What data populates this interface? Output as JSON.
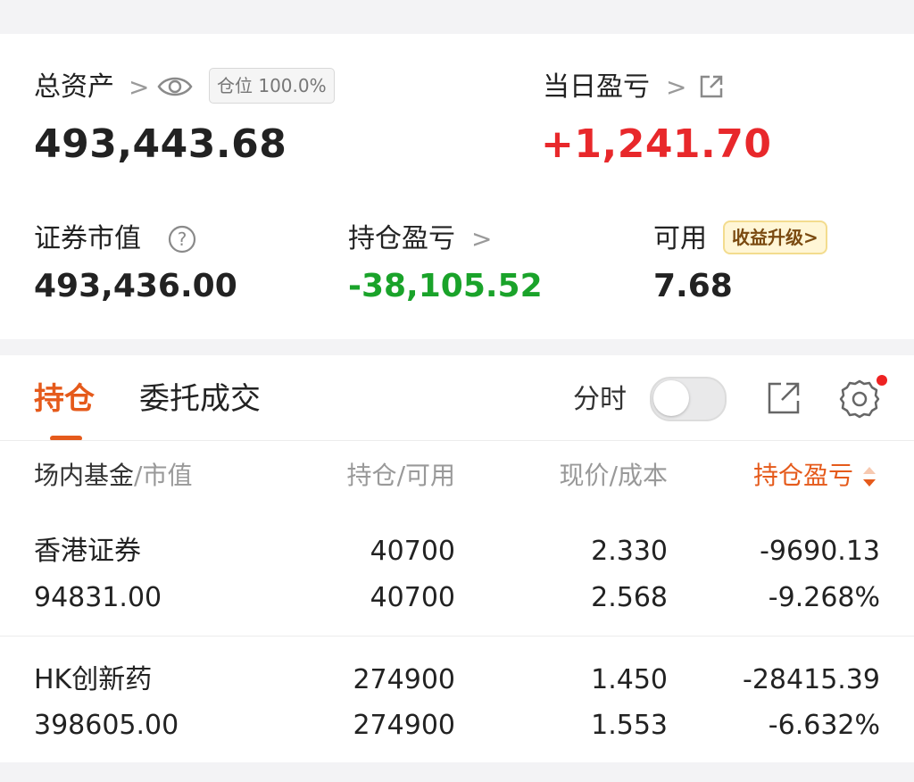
{
  "summary": {
    "total_assets_label": "总资产",
    "position_badge": "仓位 100.0%",
    "total_assets_value": "493,443.68",
    "daily_pnl_label": "当日盈亏",
    "daily_pnl_value": "+1,241.70",
    "securities_value_label": "证券市值",
    "securities_value": "493,436.00",
    "holding_pnl_label": "持仓盈亏",
    "holding_pnl_value": "-38,105.52",
    "available_label": "可用",
    "available_value": "7.68",
    "upgrade_badge": "收益升级>"
  },
  "tabs": {
    "positions": "持仓",
    "orders": "委托成交",
    "timeshare_label": "分时"
  },
  "table": {
    "col1_main": "场内基金",
    "col1_sub": "/市值",
    "col2_main": "持仓",
    "col2_sub": "/可用",
    "col3_main": "现价",
    "col3_sub": "/成本",
    "col4": "持仓盈亏",
    "rows": [
      {
        "name": "香港证券",
        "market_value": "94831.00",
        "holding": "40700",
        "available": "40700",
        "price": "2.330",
        "cost": "2.568",
        "pnl": "-9690.13",
        "pnl_pct": "-9.268%"
      },
      {
        "name": "HK创新药",
        "market_value": "398605.00",
        "holding": "274900",
        "available": "274900",
        "price": "1.450",
        "cost": "1.553",
        "pnl": "-28415.39",
        "pnl_pct": "-6.632%"
      }
    ]
  },
  "colors": {
    "accent": "#e55a1b",
    "gain": "#e8282b",
    "loss": "#1aa32a"
  }
}
